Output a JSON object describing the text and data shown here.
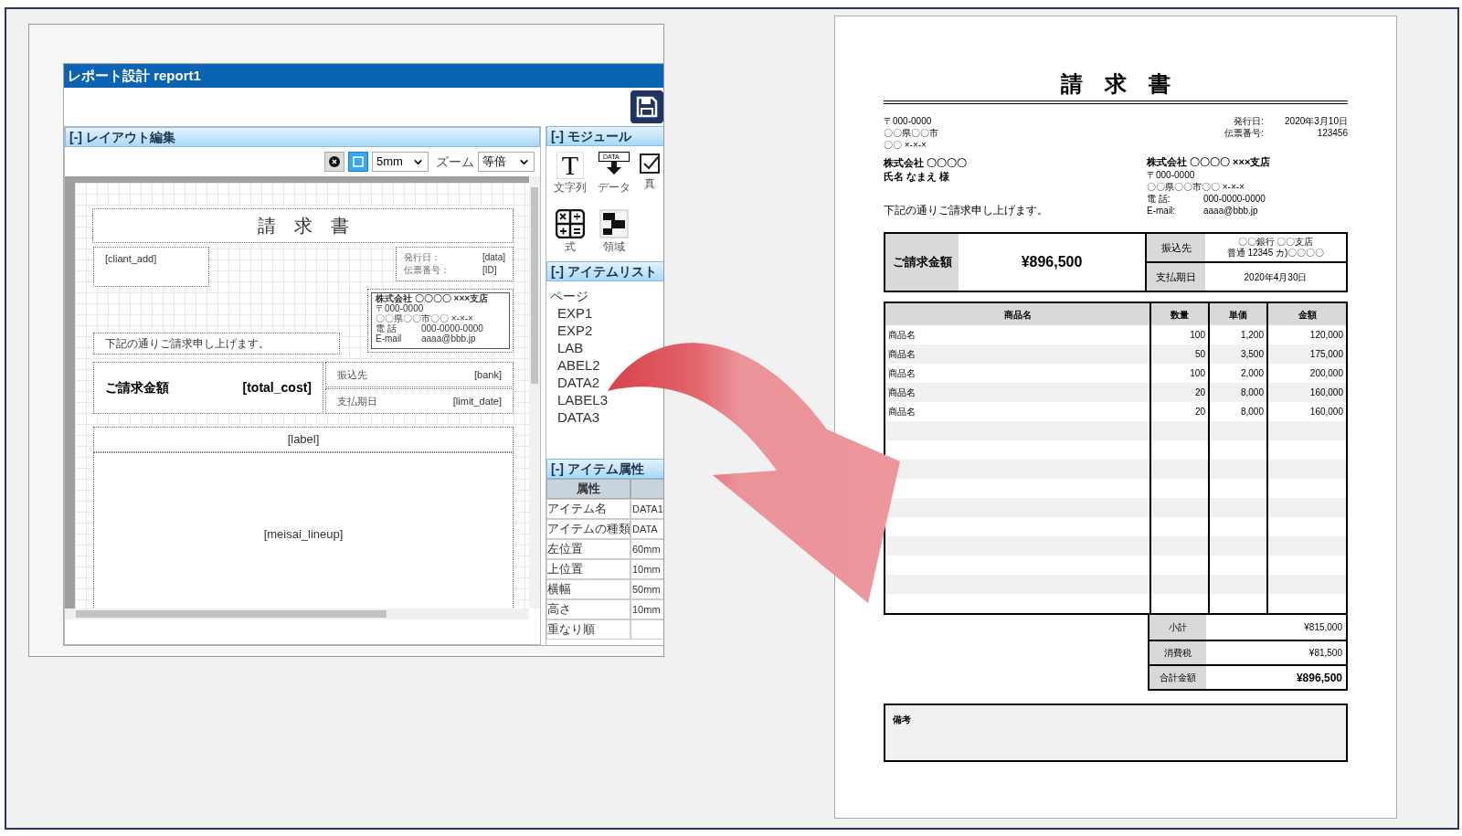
{
  "designer": {
    "title": "レポート設計 report1",
    "layout": {
      "header": "[-] レイアウト編集",
      "grid_size": "5mm",
      "zoom_label": "ズーム",
      "zoom": "等倍",
      "canvas": {
        "title": "請　求　書",
        "client_address": "[cliant_add]",
        "meta": [
          {
            "label": "発行日：",
            "value": "[data]"
          },
          {
            "label": "伝票番号：",
            "value": "[ID]"
          }
        ],
        "issuer": [
          "株式会社 〇〇〇〇 ×××支店",
          "〒000-0000",
          "〇〇県〇〇市〇〇 ×-×-×"
        ],
        "issuer_contacts": [
          {
            "label": "電 話",
            "value": "000-0000-0000"
          },
          {
            "label": "E-mail",
            "value": "aaaa@bbb.jp"
          }
        ],
        "greeting": "下記の通りご請求申し上げます。",
        "amount_label": "ご請求金額",
        "amount": "[total_cost]",
        "fields": [
          {
            "label": "振込先",
            "value": "[bank]"
          },
          {
            "label": "支払期日",
            "value": "[limit_date]"
          }
        ],
        "label": "[label]",
        "lineup": "[meisai_lineup]"
      }
    },
    "modules": {
      "header": "[-] モジュール",
      "items": [
        {
          "kind": "text",
          "glyph": "T",
          "label": "文字列"
        },
        {
          "kind": "data",
          "glyph": "DATA",
          "label": "データ"
        },
        {
          "kind": "check",
          "label": "真"
        },
        {
          "kind": "formula",
          "label": "式"
        },
        {
          "kind": "area",
          "label": "領域"
        }
      ]
    },
    "item_list": {
      "header": "[-] アイテムリスト",
      "root": "ページ",
      "items": [
        {
          "label": "EXP1"
        },
        {
          "label": "EXP2"
        },
        {
          "label": "LAB"
        },
        {
          "label": "ABEL2"
        },
        {
          "label": "DATA2"
        },
        {
          "label": "LABEL3"
        },
        {
          "label": "DATA3"
        }
      ]
    },
    "item_props": {
      "header": "[-] アイテム属性",
      "column": "属性",
      "rows": [
        {
          "name": "アイテム名",
          "value": "DATA1"
        },
        {
          "name": "アイテムの種類",
          "value": "DATA"
        },
        {
          "name": "左位置",
          "value": "60mm"
        },
        {
          "name": "上位置",
          "value": "10mm"
        },
        {
          "name": "横幅",
          "value": "50mm"
        },
        {
          "name": "高さ",
          "value": "10mm"
        },
        {
          "name": "重なり順"
        }
      ]
    }
  },
  "invoice": {
    "title": "請　求　書",
    "client_address": [
      "〒000-0000",
      "〇〇県〇〇市",
      "〇〇 ×-×-×"
    ],
    "client_company": "株式会社 〇〇〇〇",
    "client_name": "氏名 なまえ 様",
    "meta": [
      {
        "label": "発行日:",
        "value": "2020年3月10日"
      },
      {
        "label": "伝票番号:",
        "value": "123456"
      }
    ],
    "issuer": {
      "company": "株式会社 〇〇〇〇 ×××支店",
      "postal": "〒000-0000",
      "address": "〇〇県〇〇市〇〇 ×-×-×",
      "contacts": [
        {
          "label": "電 話:",
          "value": "000-0000-0000"
        },
        {
          "label": "E-mail:",
          "value": "aaaa@bbb.jp"
        }
      ]
    },
    "greeting": "下記の通りご請求申し上げます。",
    "amount_label": "ご請求金額",
    "amount": "¥896,500",
    "bank_label": "振込先",
    "bank": [
      "〇〇銀行 〇〇支店",
      "普通 12345 カ)〇〇〇〇"
    ],
    "due_label": "支払期日",
    "due": "2020年4月30日",
    "table": {
      "columns": [
        "商品名",
        "数量",
        "単価",
        "金額"
      ],
      "rows": [
        [
          "商品名",
          "100",
          "1,200",
          "120,000"
        ],
        [
          "商品名",
          "50",
          "3,500",
          "175,000"
        ],
        [
          "商品名",
          "100",
          "2,000",
          "200,000"
        ],
        [
          "商品名",
          "20",
          "8,000",
          "160,000"
        ],
        [
          "商品名",
          "20",
          "8,000",
          "160,000"
        ]
      ]
    },
    "totals": [
      {
        "label": "小計",
        "value": "¥815,000",
        "emphasis": false
      },
      {
        "label": "消費税",
        "value": "¥81,500",
        "emphasis": false
      },
      {
        "label": "合計金額",
        "value": "¥896,500",
        "emphasis": true
      }
    ],
    "remarks_label": "備考"
  }
}
